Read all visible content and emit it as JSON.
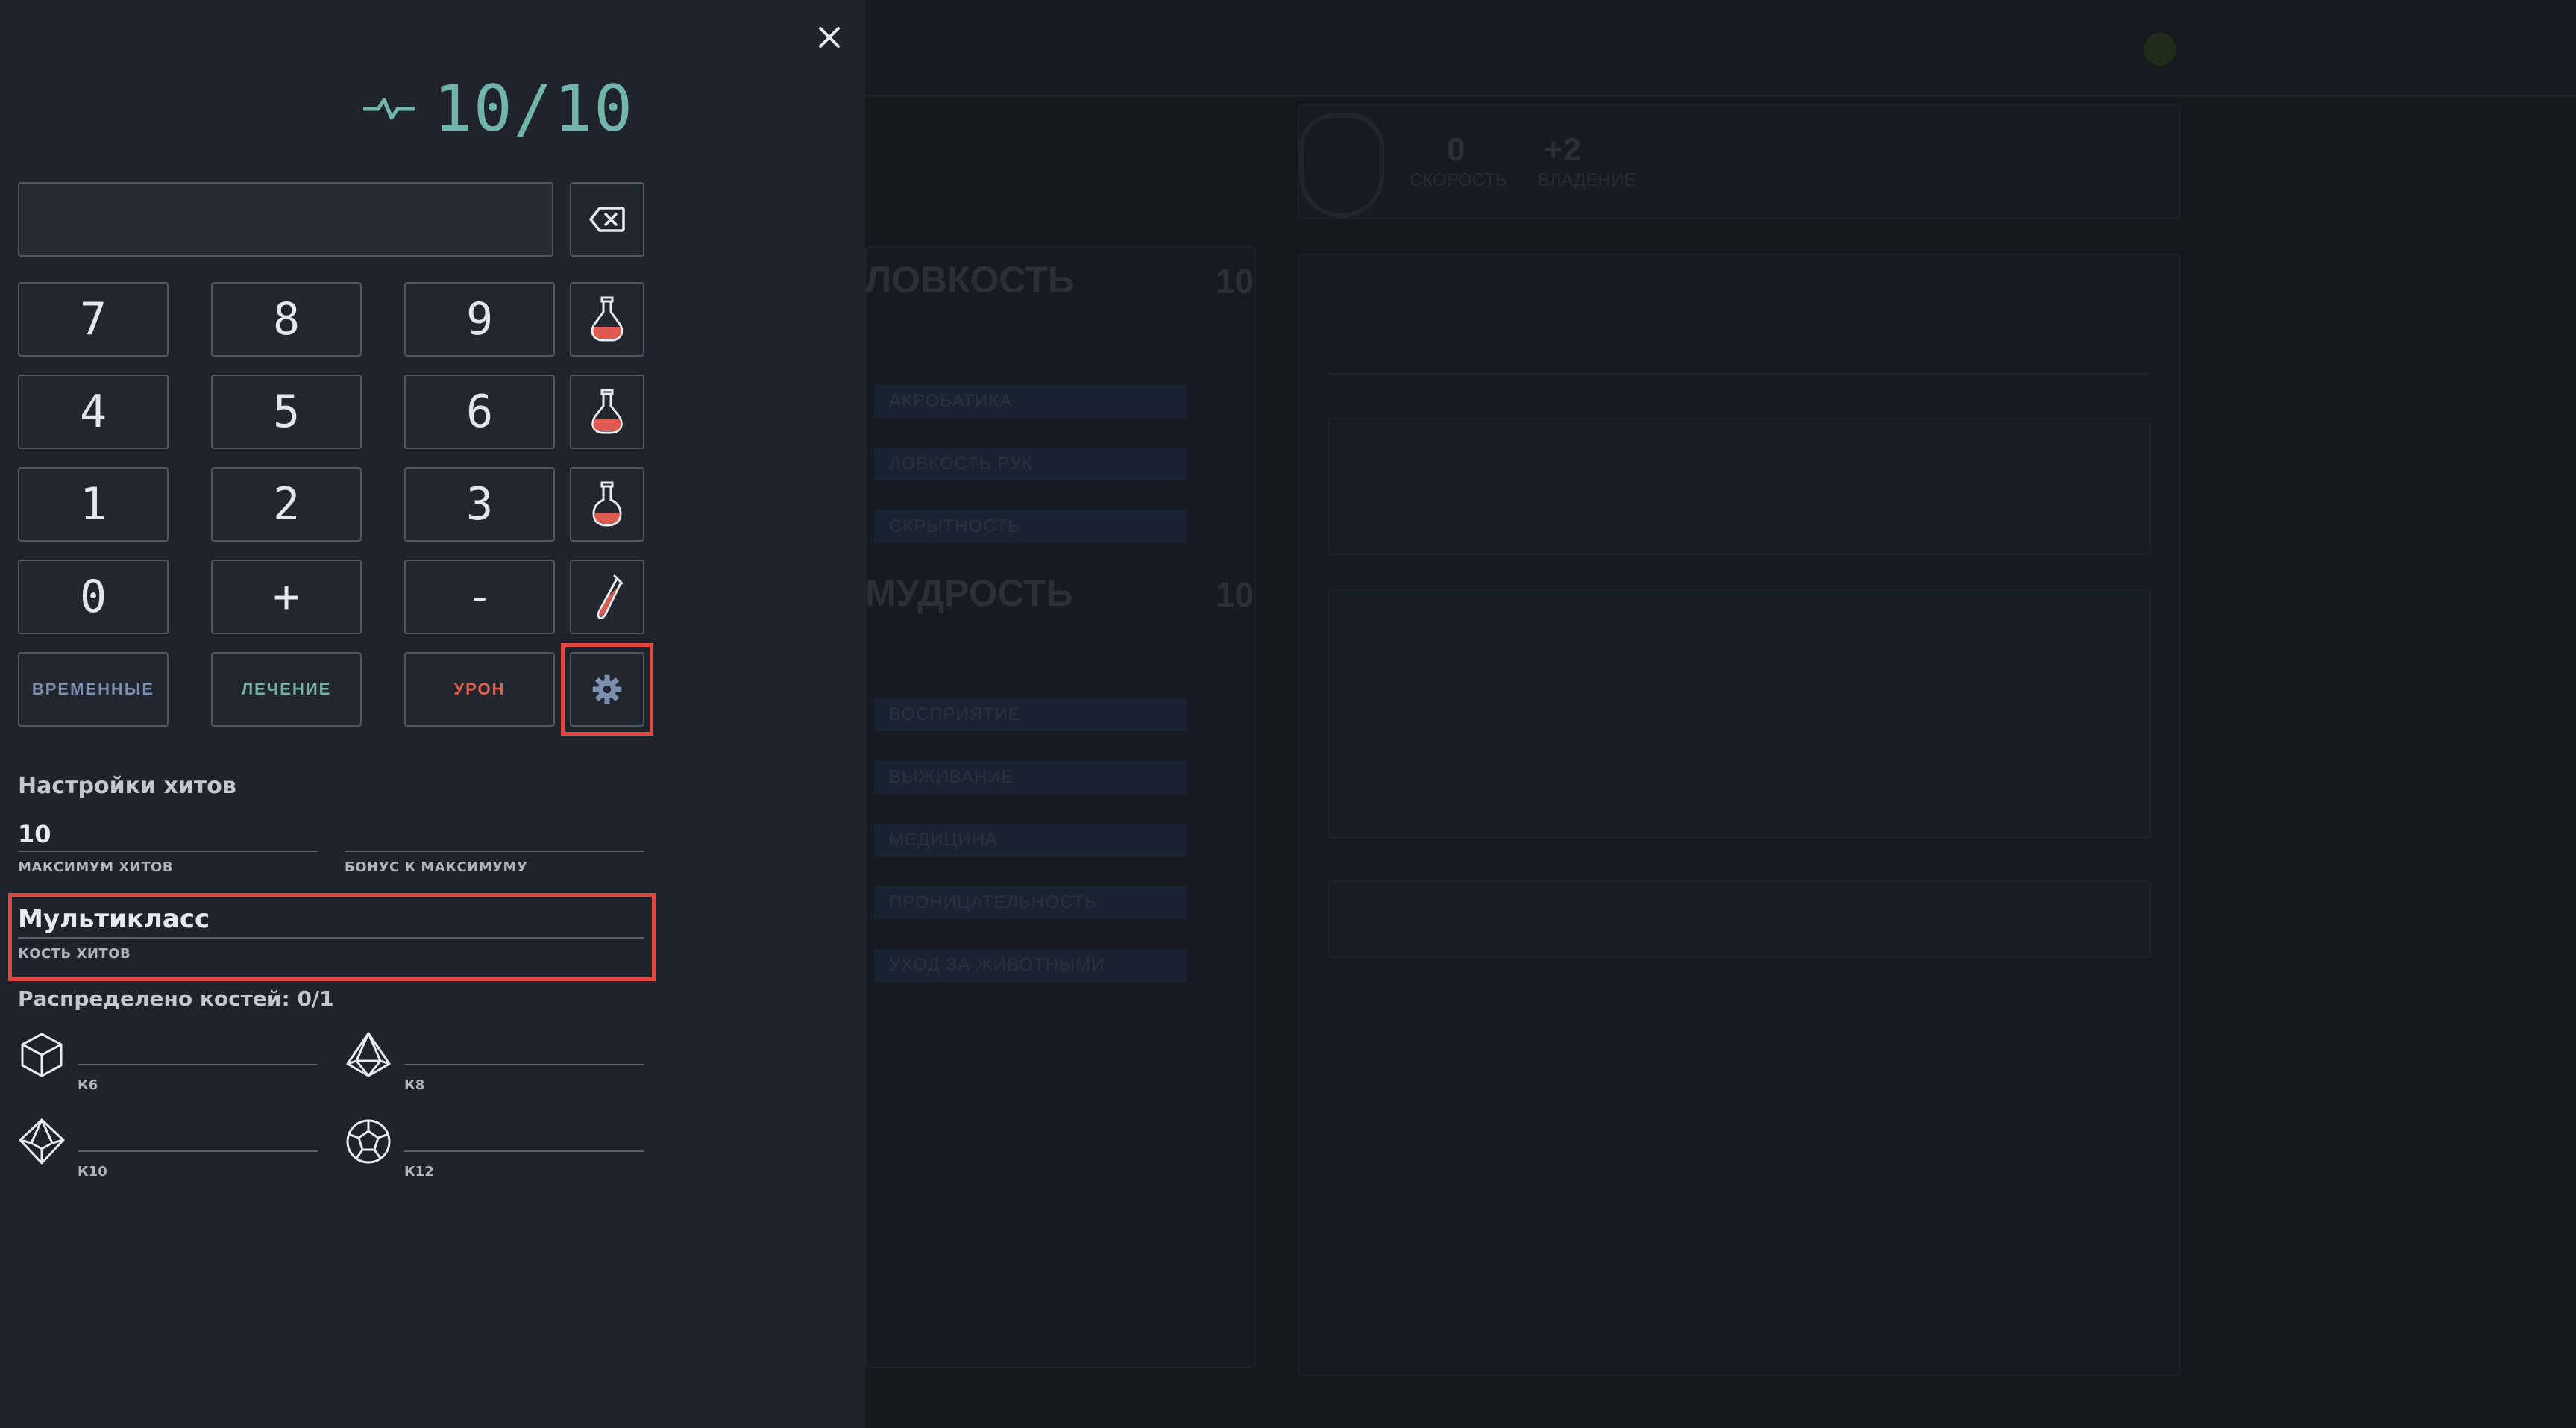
{
  "hp": {
    "current_max": "10/10"
  },
  "input": {
    "placeholder": "",
    "value": ""
  },
  "keypad": {
    "keys": [
      "7",
      "8",
      "9",
      "4",
      "5",
      "6",
      "1",
      "2",
      "3",
      "0",
      "+",
      "-"
    ],
    "temp_label": "ВРЕМЕННЫЕ",
    "heal_label": "ЛЕЧЕНИЕ",
    "damage_label": "УРОН"
  },
  "settings": {
    "title": "Настройки хитов",
    "max_hp_value": "10",
    "max_hp_caption": "МАКСИМУМ ХИТОВ",
    "bonus_value": "",
    "bonus_caption": "БОНУС К МАКСИМУМУ",
    "hit_die_value": "Мультикласс",
    "hit_die_caption": "КОСТЬ ХИТОВ",
    "distributed": "Распределено костей: 0/1",
    "dice": [
      {
        "label": "К6",
        "icon": "d6-icon"
      },
      {
        "label": "К8",
        "icon": "d8-icon"
      },
      {
        "label": "К10",
        "icon": "d10-icon"
      },
      {
        "label": "К12",
        "icon": "d12-icon"
      }
    ]
  },
  "colors": {
    "accent": "#72b5ac",
    "damage": "#e2604d",
    "temp": "#7c8fae",
    "highlight": "#e0473a",
    "potion": "#e05a4f"
  },
  "background": {
    "sections": [
      "ЛОВКОСТЬ",
      "МУДРОСТЬ"
    ],
    "section_values": [
      "10",
      "10"
    ],
    "dex_skills": [
      "АКРОБАТИКА",
      "ЛОВКОСТЬ РУК",
      "СКРЫТНОСТЬ"
    ],
    "wis_skills": [
      "ВОСПРИЯТИЕ",
      "ВЫЖИВАНИЕ",
      "МЕДИЦИНА",
      "ПРОНИЦАТЕЛЬНОСТЬ",
      "УХОД ЗА ЖИВОТНЫМИ"
    ],
    "stats": [
      "0",
      "+2"
    ],
    "stats_labels": [
      "СКОРОСТЬ",
      "ВЛАДЕНИЕ"
    ]
  }
}
